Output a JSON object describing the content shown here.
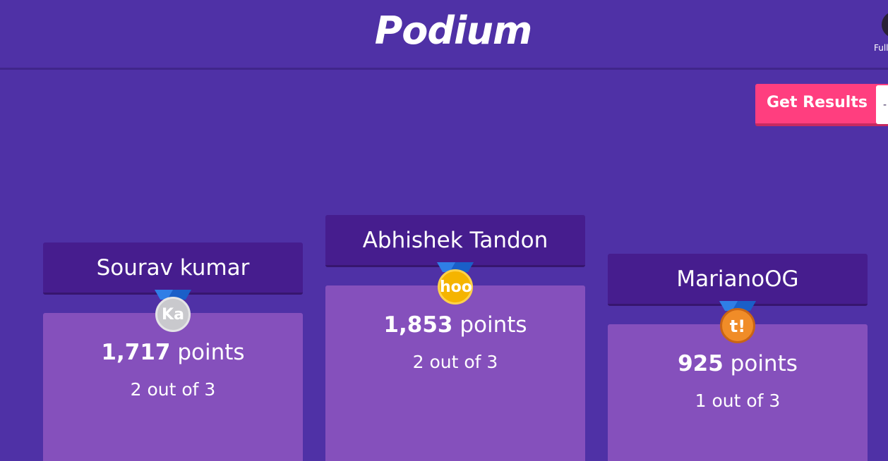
{
  "header": {
    "title": "Podium",
    "fullscreen_label": "Full"
  },
  "actions": {
    "get_results_label": "Get Results",
    "dropdown_glyph": "-"
  },
  "podium": {
    "second": {
      "name": "Sourav kumar",
      "points_value": "1,717",
      "points_unit": "points",
      "correct": "2 out of 3",
      "medal": "silver",
      "medal_glyph": "Ka"
    },
    "first": {
      "name": "Abhishek Tandon",
      "points_value": "1,853",
      "points_unit": "points",
      "correct": "2 out of 3",
      "medal": "gold",
      "medal_glyph": "hoo"
    },
    "third": {
      "name": "MarianoOG",
      "points_value": "925",
      "points_unit": "points",
      "correct": "1 out of 3",
      "medal": "bronze",
      "medal_glyph": "t!"
    }
  },
  "colors": {
    "background": "#4f31a6",
    "name_card": "#461d8e",
    "pillar": "#8550bc",
    "accent_button": "#ff3e7f",
    "gold": "#f5b400",
    "silver": "#c9c9cd",
    "bronze": "#f08c28"
  }
}
